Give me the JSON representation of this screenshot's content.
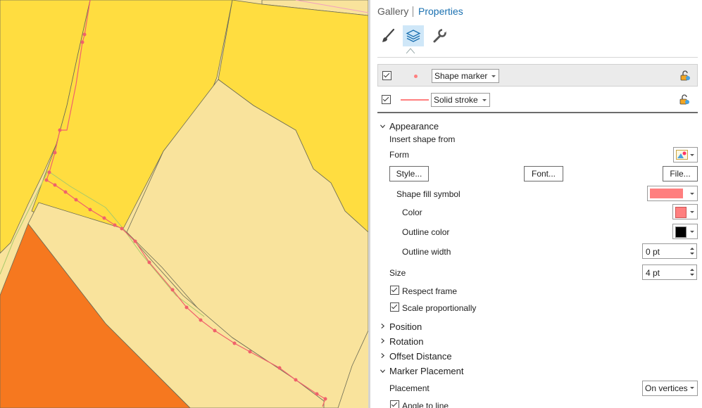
{
  "tabs": {
    "gallery": "Gallery",
    "properties": "Properties"
  },
  "toolbar_icons": [
    "paintbrush-icon",
    "layers-icon",
    "wrench-icon"
  ],
  "layers": [
    {
      "label": "Shape marker",
      "checked": true,
      "selected": true
    },
    {
      "label": "Solid stroke",
      "checked": true,
      "selected": false
    }
  ],
  "appearance": {
    "header": "Appearance",
    "insert_shape_from": "Insert shape from",
    "form": "Form",
    "style_btn": "Style...",
    "font_btn": "Font...",
    "file_btn": "File...",
    "shape_fill_symbol": "Shape fill symbol",
    "color": "Color",
    "outline_color": "Outline color",
    "outline_width": "Outline width",
    "outline_width_value": "0 pt",
    "size": "Size",
    "size_value": "4 pt",
    "respect_frame": "Respect frame",
    "scale_proportionally": "Scale proportionally"
  },
  "sections": {
    "position": "Position",
    "rotation": "Rotation",
    "offset_distance": "Offset Distance",
    "marker_placement": "Marker Placement"
  },
  "marker_placement": {
    "placement": "Placement",
    "placement_value": "On vertices",
    "angle_to_line": "Angle to line"
  },
  "colors": {
    "fill_swatch": "#ff7f7f",
    "outline_swatch": "#000000",
    "accent": "#1a70b0",
    "map_yellow": "#ffdd40",
    "map_cream": "#f9e39c",
    "map_orange": "#f6781f",
    "route_line": "#f0626b"
  }
}
